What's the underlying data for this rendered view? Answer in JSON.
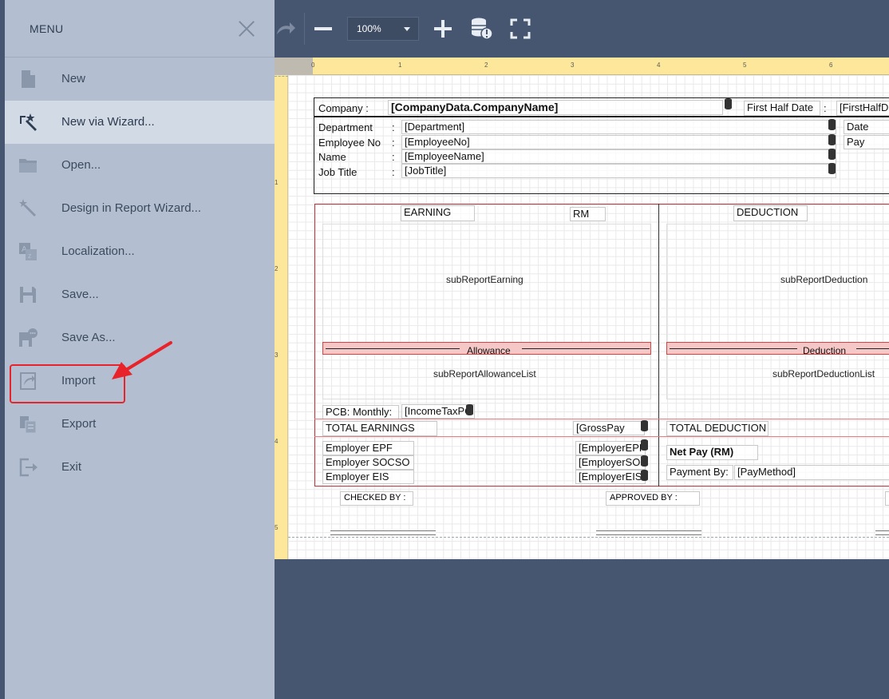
{
  "menu": {
    "title": "MENU",
    "items": [
      {
        "label": "New",
        "icon": "new-file-icon"
      },
      {
        "label": "New via Wizard...",
        "icon": "magic-wand-icon"
      },
      {
        "label": "Open...",
        "icon": "folder-icon"
      },
      {
        "label": "Design in Report Wizard...",
        "icon": "wand-icon"
      },
      {
        "label": "Localization...",
        "icon": "localization-icon"
      },
      {
        "label": "Save...",
        "icon": "save-icon"
      },
      {
        "label": "Save As...",
        "icon": "save-as-icon"
      },
      {
        "label": "Import",
        "icon": "import-icon"
      },
      {
        "label": "Export",
        "icon": "export-icon"
      },
      {
        "label": "Exit",
        "icon": "exit-icon"
      }
    ],
    "active_index": 1,
    "highlighted_index": 7
  },
  "toolbar": {
    "zoom": "100%"
  },
  "ruler": {
    "top_ticks": [
      "0",
      "1",
      "2",
      "3",
      "4",
      "5",
      "6"
    ],
    "left_ticks": [
      "1",
      "2",
      "3",
      "4",
      "5"
    ]
  },
  "report": {
    "company_label": "Company :",
    "company_field": "[CompanyData.CompanyName]",
    "first_half_date_label": "First Half Date",
    "colon": ":",
    "first_half_field": "[FirstHalfD",
    "date_label": "Date",
    "pay_label": "Pay",
    "department_label": "Department",
    "department_field": "[Department]",
    "employee_no_label": "Employee No",
    "employee_no_field": "[EmployeeNo]",
    "name_label": "Name",
    "name_field": "[EmployeeName]",
    "job_title_label": "Job Title",
    "job_title_field": "[JobTitle]",
    "earning_label": "EARNING",
    "rm_label": "RM",
    "deduction_label": "DEDUCTION",
    "sub_earning": "subReportEarning",
    "sub_deduction": "subReportDeduction",
    "allowance_label": "Allowance",
    "deduction_bar_label": "Deduction",
    "sub_allowance_list": "subReportAllowanceList",
    "sub_deduction_list": "subReportDeductionList",
    "pcb_label": "PCB: Monthly:",
    "income_tax_field": "[IncomeTaxPC",
    "total_earnings_label": "TOTAL EARNINGS",
    "gross_pay_field": "[GrossPay",
    "total_deduction_label": "TOTAL DEDUCTION",
    "employer_epf_label": "Employer EPF",
    "employer_socso_label": "Employer SOCSO",
    "employer_eis_label": "Employer EIS",
    "employer_epf_field": "[EmployerEPF",
    "employer_socso_field": "[EmployerSOC",
    "employer_eis_field": "[EmployerEIS",
    "net_pay_label": "Net Pay (RM)",
    "payment_by_label": "Payment By:",
    "pay_method_field": "[PayMethod]",
    "checked_by_label": "CHECKED BY :",
    "approved_by_label": "APPROVED BY :"
  }
}
